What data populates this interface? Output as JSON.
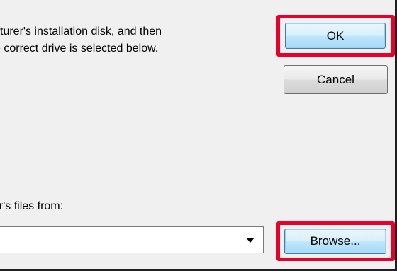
{
  "dialog": {
    "instruction_line1": "cturer's installation disk, and then",
    "instruction_line2": "e correct drive is selected below.",
    "ok_label": "OK",
    "cancel_label": "Cancel",
    "copy_from_label": "er's files from:",
    "copy_from_value": "",
    "browse_label": "Browse...",
    "dropdown_icon": "chevron-down-icon"
  },
  "colors": {
    "highlight": "#e8002a",
    "window_bg": "#f0f0f0"
  }
}
